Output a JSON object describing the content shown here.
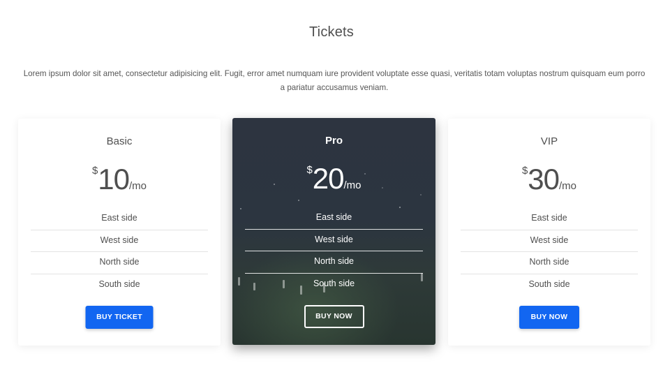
{
  "page": {
    "title": "Tickets",
    "intro": "Lorem ipsum dolor sit amet, consectetur adipisicing elit. Fugit, error amet numquam iure provident voluptate esse quasi, veritatis totam voluptas nostrum quisquam eum porro a pariatur accusamus veniam."
  },
  "colors": {
    "primary": "#1266f1",
    "text": "#4f4f4f",
    "dark_card": "#2c3540"
  },
  "plans": [
    {
      "name": "Basic",
      "currency": "$",
      "amount": "10",
      "period": "/mo",
      "features": [
        "East side",
        "West side",
        "North side",
        "South side"
      ],
      "button": "BUY TICKET"
    },
    {
      "name": "Pro",
      "currency": "$",
      "amount": "20",
      "period": "/mo",
      "features": [
        "East side",
        "West side",
        "North side",
        "South side"
      ],
      "button": "BUY NOW"
    },
    {
      "name": "VIP",
      "currency": "$",
      "amount": "30",
      "period": "/mo",
      "features": [
        "East side",
        "West side",
        "North side",
        "South side"
      ],
      "button": "BUY NOW"
    }
  ]
}
